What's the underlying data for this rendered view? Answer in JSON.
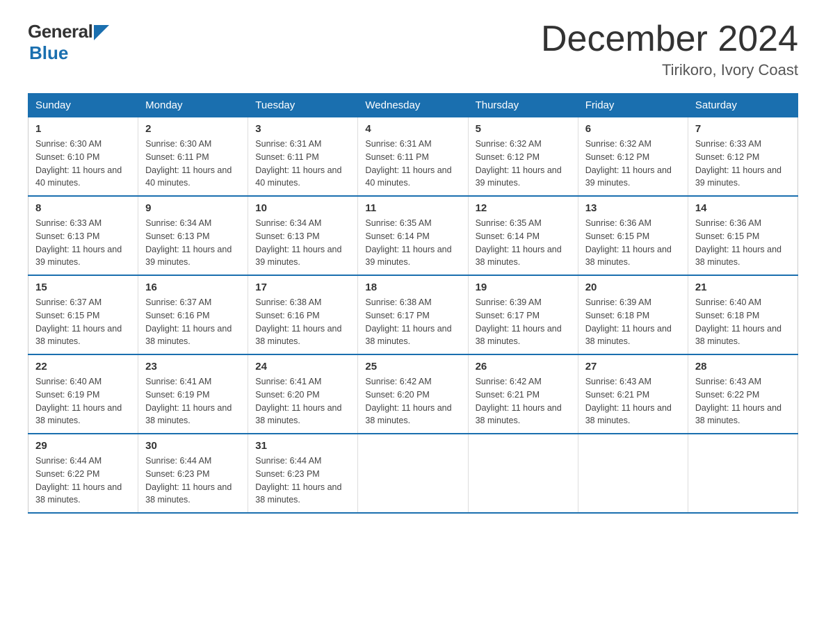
{
  "logo": {
    "name": "General",
    "name2": "Blue"
  },
  "header": {
    "month": "December 2024",
    "location": "Tirikoro, Ivory Coast"
  },
  "weekdays": [
    "Sunday",
    "Monday",
    "Tuesday",
    "Wednesday",
    "Thursday",
    "Friday",
    "Saturday"
  ],
  "weeks": [
    [
      {
        "day": 1,
        "sunrise": "6:30 AM",
        "sunset": "6:10 PM",
        "daylight": "11 hours and 40 minutes."
      },
      {
        "day": 2,
        "sunrise": "6:30 AM",
        "sunset": "6:11 PM",
        "daylight": "11 hours and 40 minutes."
      },
      {
        "day": 3,
        "sunrise": "6:31 AM",
        "sunset": "6:11 PM",
        "daylight": "11 hours and 40 minutes."
      },
      {
        "day": 4,
        "sunrise": "6:31 AM",
        "sunset": "6:11 PM",
        "daylight": "11 hours and 40 minutes."
      },
      {
        "day": 5,
        "sunrise": "6:32 AM",
        "sunset": "6:12 PM",
        "daylight": "11 hours and 39 minutes."
      },
      {
        "day": 6,
        "sunrise": "6:32 AM",
        "sunset": "6:12 PM",
        "daylight": "11 hours and 39 minutes."
      },
      {
        "day": 7,
        "sunrise": "6:33 AM",
        "sunset": "6:12 PM",
        "daylight": "11 hours and 39 minutes."
      }
    ],
    [
      {
        "day": 8,
        "sunrise": "6:33 AM",
        "sunset": "6:13 PM",
        "daylight": "11 hours and 39 minutes."
      },
      {
        "day": 9,
        "sunrise": "6:34 AM",
        "sunset": "6:13 PM",
        "daylight": "11 hours and 39 minutes."
      },
      {
        "day": 10,
        "sunrise": "6:34 AM",
        "sunset": "6:13 PM",
        "daylight": "11 hours and 39 minutes."
      },
      {
        "day": 11,
        "sunrise": "6:35 AM",
        "sunset": "6:14 PM",
        "daylight": "11 hours and 39 minutes."
      },
      {
        "day": 12,
        "sunrise": "6:35 AM",
        "sunset": "6:14 PM",
        "daylight": "11 hours and 38 minutes."
      },
      {
        "day": 13,
        "sunrise": "6:36 AM",
        "sunset": "6:15 PM",
        "daylight": "11 hours and 38 minutes."
      },
      {
        "day": 14,
        "sunrise": "6:36 AM",
        "sunset": "6:15 PM",
        "daylight": "11 hours and 38 minutes."
      }
    ],
    [
      {
        "day": 15,
        "sunrise": "6:37 AM",
        "sunset": "6:15 PM",
        "daylight": "11 hours and 38 minutes."
      },
      {
        "day": 16,
        "sunrise": "6:37 AM",
        "sunset": "6:16 PM",
        "daylight": "11 hours and 38 minutes."
      },
      {
        "day": 17,
        "sunrise": "6:38 AM",
        "sunset": "6:16 PM",
        "daylight": "11 hours and 38 minutes."
      },
      {
        "day": 18,
        "sunrise": "6:38 AM",
        "sunset": "6:17 PM",
        "daylight": "11 hours and 38 minutes."
      },
      {
        "day": 19,
        "sunrise": "6:39 AM",
        "sunset": "6:17 PM",
        "daylight": "11 hours and 38 minutes."
      },
      {
        "day": 20,
        "sunrise": "6:39 AM",
        "sunset": "6:18 PM",
        "daylight": "11 hours and 38 minutes."
      },
      {
        "day": 21,
        "sunrise": "6:40 AM",
        "sunset": "6:18 PM",
        "daylight": "11 hours and 38 minutes."
      }
    ],
    [
      {
        "day": 22,
        "sunrise": "6:40 AM",
        "sunset": "6:19 PM",
        "daylight": "11 hours and 38 minutes."
      },
      {
        "day": 23,
        "sunrise": "6:41 AM",
        "sunset": "6:19 PM",
        "daylight": "11 hours and 38 minutes."
      },
      {
        "day": 24,
        "sunrise": "6:41 AM",
        "sunset": "6:20 PM",
        "daylight": "11 hours and 38 minutes."
      },
      {
        "day": 25,
        "sunrise": "6:42 AM",
        "sunset": "6:20 PM",
        "daylight": "11 hours and 38 minutes."
      },
      {
        "day": 26,
        "sunrise": "6:42 AM",
        "sunset": "6:21 PM",
        "daylight": "11 hours and 38 minutes."
      },
      {
        "day": 27,
        "sunrise": "6:43 AM",
        "sunset": "6:21 PM",
        "daylight": "11 hours and 38 minutes."
      },
      {
        "day": 28,
        "sunrise": "6:43 AM",
        "sunset": "6:22 PM",
        "daylight": "11 hours and 38 minutes."
      }
    ],
    [
      {
        "day": 29,
        "sunrise": "6:44 AM",
        "sunset": "6:22 PM",
        "daylight": "11 hours and 38 minutes."
      },
      {
        "day": 30,
        "sunrise": "6:44 AM",
        "sunset": "6:23 PM",
        "daylight": "11 hours and 38 minutes."
      },
      {
        "day": 31,
        "sunrise": "6:44 AM",
        "sunset": "6:23 PM",
        "daylight": "11 hours and 38 minutes."
      },
      null,
      null,
      null,
      null
    ]
  ]
}
